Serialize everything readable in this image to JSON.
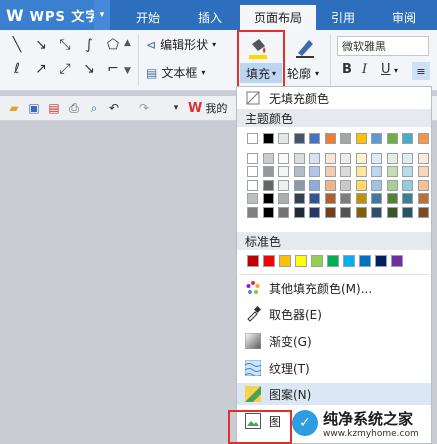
{
  "app": {
    "logo_mark": "W",
    "title": "WPS 文字",
    "drop": "▾"
  },
  "tabs": [
    {
      "label": "开始"
    },
    {
      "label": "插入"
    },
    {
      "label": "页面布局"
    },
    {
      "label": "引用"
    },
    {
      "label": "审阅"
    }
  ],
  "ribbon": {
    "edit_shape": "编辑形状",
    "text_box": "文本框",
    "fill": "填充",
    "outline": "轮廓",
    "font_name": "微软雅黑",
    "bold": "B",
    "italic": "I",
    "underline": "U"
  },
  "doc_tab": {
    "wps": "W",
    "label": "我的"
  },
  "panel": {
    "no_fill": "无填充颜色",
    "theme_colors": "主题颜色",
    "standard_colors": "标准色",
    "more_colors": "其他填充颜色(M)...",
    "picker": "取色器(E)",
    "gradient": "渐变(G)",
    "texture": "纹理(T)",
    "pattern": "图案(N)",
    "picture": "图"
  },
  "colors": {
    "theme_top": [
      "#ffffff",
      "#000000",
      "#e7e6e6",
      "#44546a",
      "#4472c4",
      "#ed7d31",
      "#a5a5a5",
      "#ffc000",
      "#5b9bd5",
      "#70ad47",
      "#4bacc6",
      "#f79646"
    ],
    "standard": [
      "#c00000",
      "#ff0000",
      "#ffc000",
      "#ffff00",
      "#92d050",
      "#00b050",
      "#00b0f0",
      "#0070c0",
      "#002060",
      "#7030a0"
    ],
    "accent_title": "#2d6fbd",
    "highlight_red": "#e0302c"
  },
  "watermark": {
    "name": "纯净系统之家",
    "url": "www.kzmyhome.com"
  }
}
